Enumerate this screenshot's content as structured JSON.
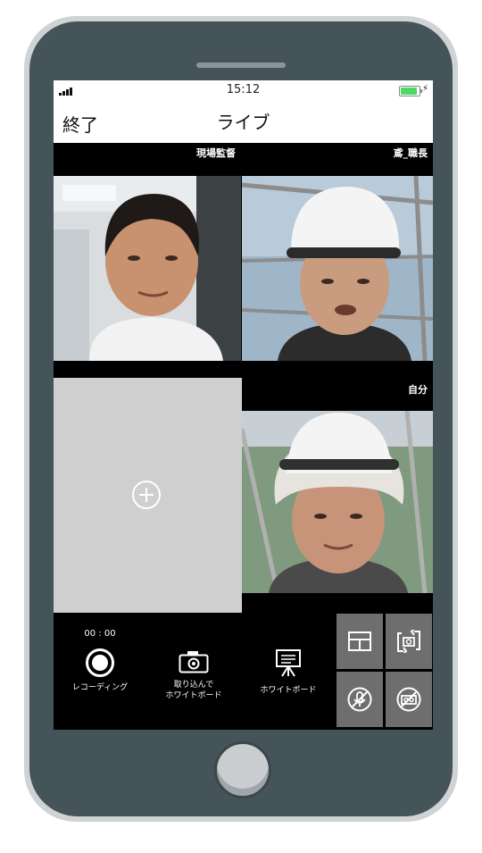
{
  "status_bar": {
    "time": "15:12"
  },
  "nav": {
    "end_label": "終了",
    "title": "ライブ"
  },
  "participants": [
    {
      "label": "現場監督"
    },
    {
      "label": "鳶_職長"
    },
    {
      "label": "自分"
    }
  ],
  "toolbar": {
    "record_time": "00 : 00",
    "recording_label": "レコーディング",
    "capture_label": "取り込んで\nホワイトボード",
    "whiteboard_label": "ホワイトボード"
  },
  "colors": {
    "phone_body": "#455459",
    "screen_bg": "#000000",
    "empty_slot": "#cfcfcf",
    "control_button": "#6e6e6e",
    "battery": "#4cd964"
  },
  "icons": [
    "add-participant-icon",
    "record-icon",
    "camera-icon",
    "whiteboard-icon",
    "layout-icon",
    "switch-camera-icon",
    "mute-mic-icon",
    "video-off-icon"
  ]
}
